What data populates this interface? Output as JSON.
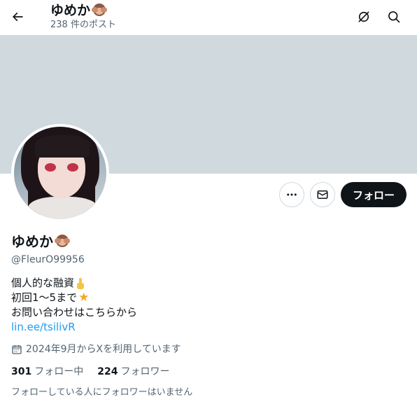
{
  "header": {
    "name": "ゆめか",
    "post_count": "238 件のポスト",
    "icons": [
      "back-arrow-icon",
      "grok-icon",
      "search-icon"
    ]
  },
  "profile": {
    "display_name": "ゆめか",
    "handle": "@FleurO99956",
    "bio_lines": [
      "個人的な融資",
      "初回1〜5まで",
      "お問い合わせはこちらから"
    ],
    "link": "lin.ee/tsilivR",
    "joined": "2024年9月からXを利用しています",
    "following_count": "301",
    "following_label": "フォロー中",
    "followers_count": "224",
    "followers_label": "フォロワー",
    "followed_by_note": "フォローしている人にフォロワーはいません"
  },
  "actions": {
    "follow_label": "フォロー",
    "more_icon": "more-horizontal-icon",
    "mail_icon": "mail-icon"
  },
  "colors": {
    "banner": "#cfd9de",
    "link": "#1d9bf0",
    "follow_bg": "#0f1419",
    "muted_text": "#536471"
  }
}
